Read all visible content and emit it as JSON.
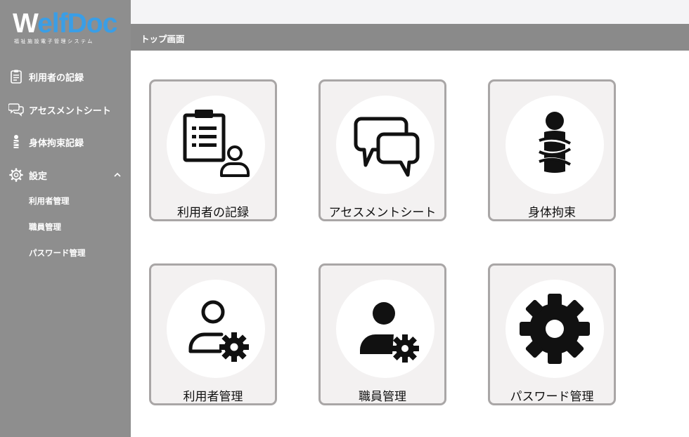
{
  "colors": {
    "sidebar_bg": "#8e8e8e",
    "titlebar_bg": "#8a8a8a",
    "topbar_bg": "#f4f4f6",
    "tile_bg": "#f3f1f1",
    "tile_border": "#a9a6a6",
    "logo_accent": "#3a9ee6"
  },
  "logo": {
    "text_white": "W",
    "text_rest": "elfDoc",
    "subtitle": "福祉施設電子管理システム"
  },
  "sidebar": {
    "items": [
      {
        "label": "利用者の記録",
        "icon": "clipboard-icon"
      },
      {
        "label": "アセスメントシート",
        "icon": "speech-bubbles-icon"
      },
      {
        "label": "身体拘束記録",
        "icon": "restrained-person-icon"
      },
      {
        "label": "設定",
        "icon": "gear-icon",
        "expanded": true
      }
    ],
    "settings_subitems": [
      {
        "label": "利用者管理"
      },
      {
        "label": "職員管理"
      },
      {
        "label": "パスワード管理"
      }
    ]
  },
  "header": {
    "page_title": "トップ画面"
  },
  "tiles": [
    {
      "label": "利用者の記録",
      "icon": "clipboard-user-icon"
    },
    {
      "label": "アセスメントシート",
      "icon": "speech-bubbles-icon"
    },
    {
      "label": "身体拘束",
      "icon": "restrained-person-icon"
    },
    {
      "label": "利用者管理",
      "icon": "user-gear-outline-icon"
    },
    {
      "label": "職員管理",
      "icon": "user-gear-solid-icon"
    },
    {
      "label": "パスワード管理",
      "icon": "gear-icon"
    }
  ]
}
